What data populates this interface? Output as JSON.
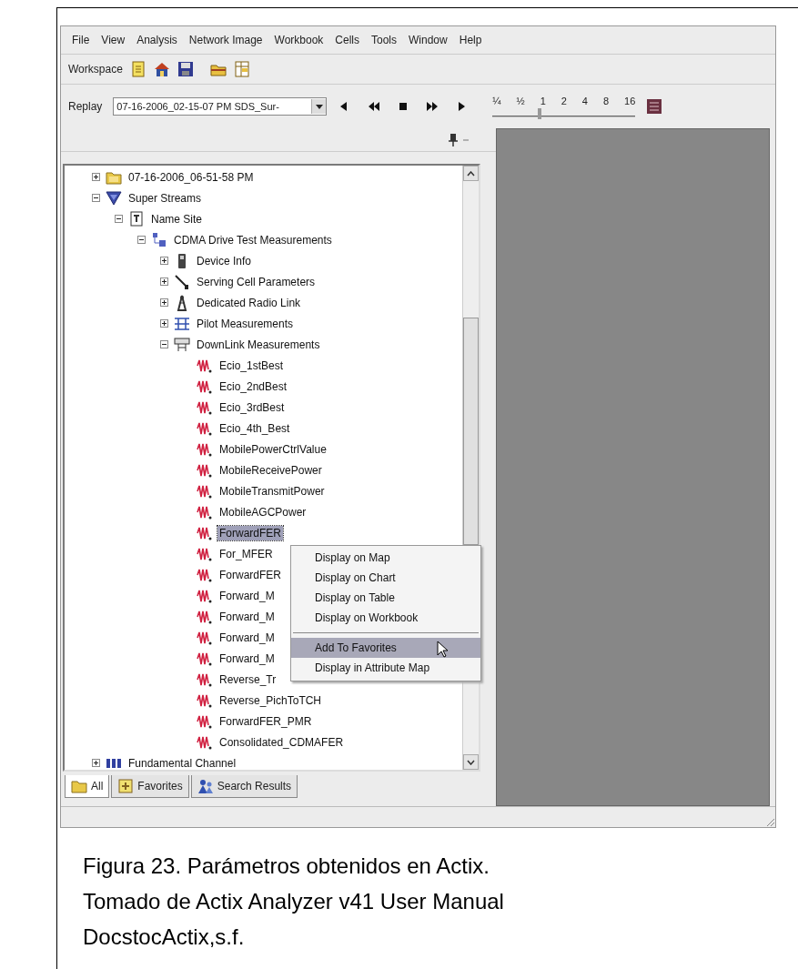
{
  "menu_bar": [
    "File",
    "View",
    "Analysis",
    "Network Image",
    "Workbook",
    "Cells",
    "Tools",
    "Window",
    "Help"
  ],
  "toolbar": {
    "label": "Workspace"
  },
  "replay": {
    "label": "Replay",
    "file": "07-16-2006_02-15-07 PM SDS_Sur-",
    "speed_labels": [
      "¼",
      "½",
      "1",
      "2",
      "4",
      "8",
      "16"
    ],
    "speed": {
      "level": 0.33
    }
  },
  "tree": [
    {
      "label": "07-16-2006_06-51-58 PM",
      "kind": "folder",
      "expanded": false,
      "selected": false
    },
    {
      "label": "Super Streams",
      "kind": "stream",
      "expanded": true,
      "selected": false,
      "children": [
        {
          "label": "Name Site",
          "kind": "site",
          "expanded": true,
          "selected": false,
          "children": [
            {
              "label": "CDMA Drive Test Measurements",
              "kind": "group",
              "expanded": true,
              "selected": false,
              "children": [
                {
                  "label": "Device Info",
                  "kind": "device",
                  "expanded": false,
                  "selected": false
                },
                {
                  "label": "Serving Cell Parameters",
                  "kind": "antenna",
                  "expanded": false,
                  "selected": false
                },
                {
                  "label": "Dedicated Radio Link",
                  "kind": "tower",
                  "expanded": false,
                  "selected": false
                },
                {
                  "label": "Pilot Measurements",
                  "kind": "pilot",
                  "expanded": false,
                  "selected": false
                },
                {
                  "label": "DownLink Measurements",
                  "kind": "downlink",
                  "expanded": true,
                  "selected": false,
                  "children": [
                    {
                      "label": "Ecio_1stBest",
                      "kind": "signal",
                      "selected": false
                    },
                    {
                      "label": "Ecio_2ndBest",
                      "kind": "signal",
                      "selected": false
                    },
                    {
                      "label": "Ecio_3rdBest",
                      "kind": "signal",
                      "selected": false
                    },
                    {
                      "label": "Ecio_4th_Best",
                      "kind": "signal",
                      "selected": false
                    },
                    {
                      "label": "MobilePowerCtrlValue",
                      "kind": "signal",
                      "selected": false
                    },
                    {
                      "label": "MobileReceivePower",
                      "kind": "signal",
                      "selected": false
                    },
                    {
                      "label": "MobileTransmitPower",
                      "kind": "signal",
                      "selected": false
                    },
                    {
                      "label": "MobileAGCPower",
                      "kind": "signal",
                      "selected": false
                    },
                    {
                      "label": "ForwardFER",
                      "kind": "signal",
                      "selected": true
                    },
                    {
                      "label": "For_MFER",
                      "kind": "signal",
                      "selected": false
                    },
                    {
                      "label": "ForwardFER",
                      "kind": "signal",
                      "selected": false
                    },
                    {
                      "label": "Forward_M",
                      "kind": "signal",
                      "selected": false
                    },
                    {
                      "label": "Forward_M",
                      "kind": "signal",
                      "selected": false
                    },
                    {
                      "label": "Forward_M",
                      "kind": "signal",
                      "selected": false
                    },
                    {
                      "label": "Forward_M",
                      "kind": "signal",
                      "selected": false
                    },
                    {
                      "label": "Reverse_Tr",
                      "kind": "signal",
                      "selected": false
                    },
                    {
                      "label": "Reverse_PichToTCH",
                      "kind": "signal",
                      "selected": false
                    },
                    {
                      "label": "ForwardFER_PMR",
                      "kind": "signal",
                      "selected": false
                    },
                    {
                      "label": "Consolidated_CDMAFER",
                      "kind": "signal",
                      "selected": false
                    }
                  ]
                }
              ]
            }
          ]
        }
      ]
    },
    {
      "label": "Fundamental Channel",
      "kind": "channel",
      "expanded": false,
      "selected": false
    }
  ],
  "context_menu": [
    {
      "kind": "command",
      "label": "Display on Map",
      "selected": false
    },
    {
      "kind": "command",
      "label": "Display on Chart",
      "selected": false
    },
    {
      "kind": "command",
      "label": "Display on Table",
      "selected": false
    },
    {
      "kind": "command",
      "label": "Display on Workbook",
      "selected": false
    },
    {
      "kind": "separator"
    },
    {
      "kind": "command",
      "label": "Add To Favorites",
      "selected": true
    },
    {
      "kind": "command",
      "label": "Display in Attribute Map",
      "selected": false
    }
  ],
  "tabs": [
    {
      "label": "All",
      "kind": "folder",
      "selected": true
    },
    {
      "label": "Favorites",
      "kind": "favorite",
      "selected": false
    },
    {
      "label": "Search Results",
      "kind": "search",
      "selected": false
    }
  ],
  "caption": [
    "Figura 23. Parámetros obtenidos en Actix.",
    "Tomado de Actix Analyzer v41 User Manual",
    "DocstocActix,s.f."
  ]
}
